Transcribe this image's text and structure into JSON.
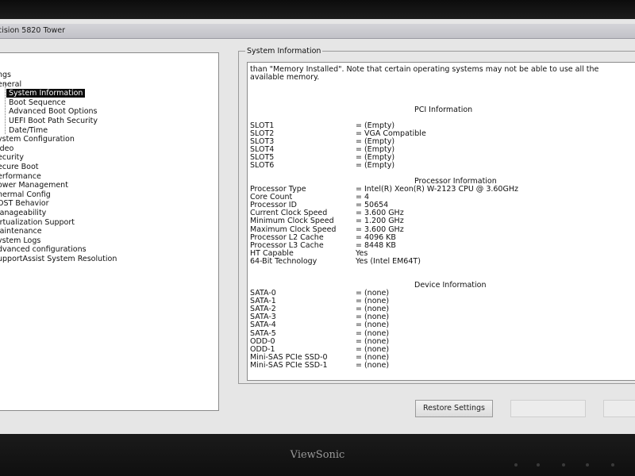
{
  "window": {
    "title": "cision 5820 Tower"
  },
  "tree": {
    "items": [
      {
        "label": "ngs",
        "child": false
      },
      {
        "label": "eneral",
        "child": false
      },
      {
        "label": "System Information",
        "child": true,
        "selected": true
      },
      {
        "label": "Boot Sequence",
        "child": true
      },
      {
        "label": "Advanced Boot Options",
        "child": true
      },
      {
        "label": "UEFI Boot Path Security",
        "child": true
      },
      {
        "label": "Date/Time",
        "child": true
      },
      {
        "label": "ystem Configuration",
        "child": false
      },
      {
        "label": "ideo",
        "child": false
      },
      {
        "label": "ecurity",
        "child": false
      },
      {
        "label": "ecure Boot",
        "child": false
      },
      {
        "label": "erformance",
        "child": false
      },
      {
        "label": "ower Management",
        "child": false
      },
      {
        "label": "hermal Config",
        "child": false
      },
      {
        "label": "OST Behavior",
        "child": false
      },
      {
        "label": "lanageability",
        "child": false
      },
      {
        "label": "irtualization Support",
        "child": false
      },
      {
        "label": "laintenance",
        "child": false
      },
      {
        "label": "ystem Logs",
        "child": false
      },
      {
        "label": "dvanced configurations",
        "child": false
      },
      {
        "label": "upportAssist System Resolution",
        "child": false
      }
    ]
  },
  "panel": {
    "title": "System Information",
    "note": "than \"Memory Installed\". Note that certain operating systems may not be able to use all the available memory.",
    "pci": {
      "heading": "PCI Information",
      "rows": [
        {
          "k": "SLOT1",
          "v": "= (Empty)"
        },
        {
          "k": "SLOT2",
          "v": "= VGA Compatible"
        },
        {
          "k": "SLOT3",
          "v": "= (Empty)"
        },
        {
          "k": "SLOT4",
          "v": "= (Empty)"
        },
        {
          "k": "SLOT5",
          "v": "= (Empty)"
        },
        {
          "k": "SLOT6",
          "v": "= (Empty)"
        }
      ]
    },
    "processor": {
      "heading": "Processor Information",
      "rows": [
        {
          "k": "Processor Type",
          "v": "= Intel(R) Xeon(R) W-2123 CPU @ 3.60GHz"
        },
        {
          "k": "Core Count",
          "v": "= 4"
        },
        {
          "k": "Processor ID",
          "v": "= 50654"
        },
        {
          "k": "Current Clock Speed",
          "v": "= 3.600 GHz"
        },
        {
          "k": "Minimum Clock Speed",
          "v": "= 1.200 GHz"
        },
        {
          "k": "Maximum Clock Speed",
          "v": "= 3.600 GHz"
        },
        {
          "k": "Processor L2 Cache",
          "v": "= 4096 KB"
        },
        {
          "k": "Processor L3 Cache",
          "v": "= 8448 KB"
        },
        {
          "k": "HT Capable",
          "v": "Yes"
        },
        {
          "k": "64-Bit Technology",
          "v": "Yes (Intel EM64T)"
        }
      ]
    },
    "device": {
      "heading": "Device Information",
      "rows": [
        {
          "k": "SATA-0",
          "v": "= (none)"
        },
        {
          "k": "SATA-1",
          "v": "= (none)"
        },
        {
          "k": "SATA-2",
          "v": "= (none)"
        },
        {
          "k": "SATA-3",
          "v": "= (none)"
        },
        {
          "k": "SATA-4",
          "v": "= (none)"
        },
        {
          "k": "SATA-5",
          "v": "= (none)"
        },
        {
          "k": "ODD-0",
          "v": "= (none)"
        },
        {
          "k": "ODD-1",
          "v": "= (none)"
        },
        {
          "k": "Mini-SAS PCIe SSD-0",
          "v": "= (none)"
        },
        {
          "k": "Mini-SAS PCIe SSD-1",
          "v": "= (none)"
        }
      ]
    }
  },
  "buttons": {
    "restore": "Restore Settings"
  },
  "monitor": {
    "brand": "ViewSonic"
  }
}
